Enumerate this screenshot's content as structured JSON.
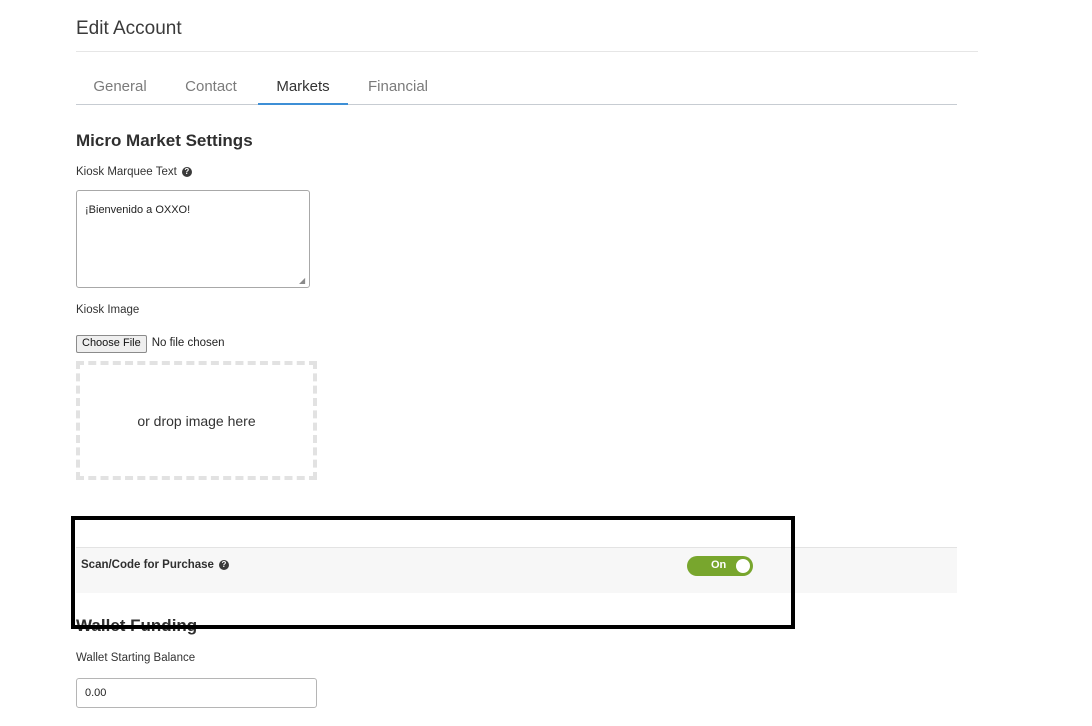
{
  "page": {
    "title": "Edit Account"
  },
  "tabs": [
    {
      "label": "General",
      "active": false
    },
    {
      "label": "Contact",
      "active": false
    },
    {
      "label": "Markets",
      "active": true
    },
    {
      "label": "Financial",
      "active": false
    }
  ],
  "micro_market": {
    "heading": "Micro Market Settings",
    "marquee_label": "Kiosk Marquee Text",
    "marquee_value": "¡Bienvenido a OXXO!",
    "image_label": "Kiosk Image",
    "choose_file_label": "Choose File",
    "no_file_text": "No file chosen",
    "dropzone_text": "or drop image here"
  },
  "scan_code": {
    "label": "Scan/Code for Purchase",
    "toggle_text": "On",
    "toggle_state": true
  },
  "wallet": {
    "heading": "Wallet Funding",
    "starting_balance_label": "Wallet Starting Balance",
    "starting_balance_value": "0.00"
  },
  "colors": {
    "accent_blue": "#3d8fd6",
    "toggle_green": "#78a62d",
    "highlight_border": "#000000"
  },
  "icons": {
    "help": "question-circle-icon"
  }
}
